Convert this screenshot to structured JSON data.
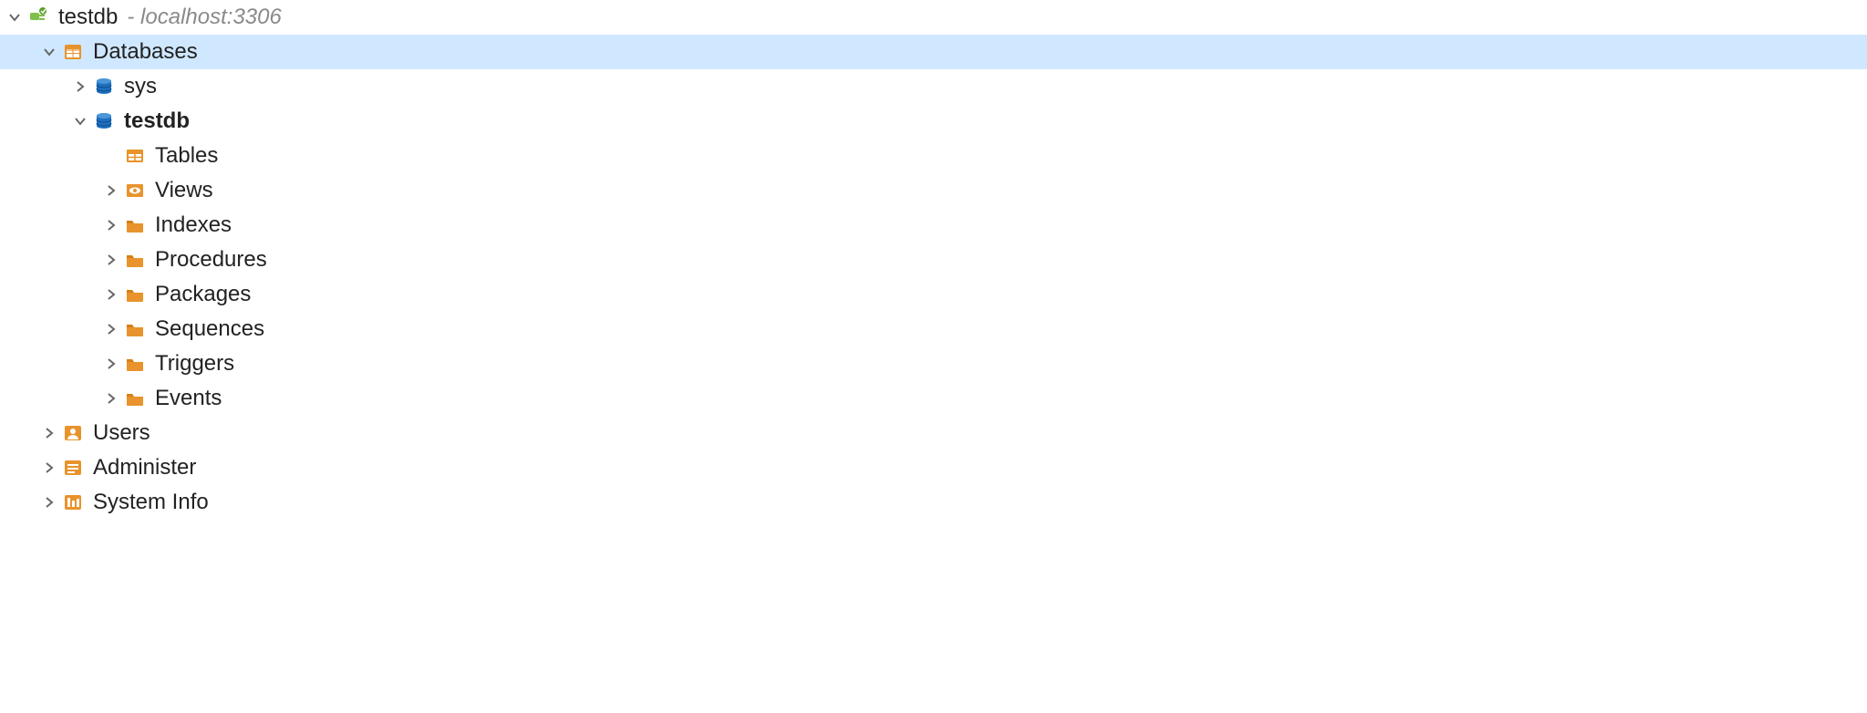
{
  "connection": {
    "name": "testdb",
    "host": "- localhost:3306"
  },
  "databases_node": {
    "label": "Databases",
    "items": [
      {
        "name": "sys",
        "bold": false
      },
      {
        "name": "testdb",
        "bold": true
      }
    ]
  },
  "schema_children": {
    "tables": "Tables",
    "views": "Views",
    "indexes": "Indexes",
    "procedures": "Procedures",
    "packages": "Packages",
    "sequences": "Sequences",
    "triggers": "Triggers",
    "events": "Events"
  },
  "root_children": {
    "users": "Users",
    "administer": "Administer",
    "system_info": "System Info"
  },
  "colors": {
    "orange": "#e8932b",
    "blue": "#1e6fbf",
    "selection": "#cfe8ff"
  }
}
